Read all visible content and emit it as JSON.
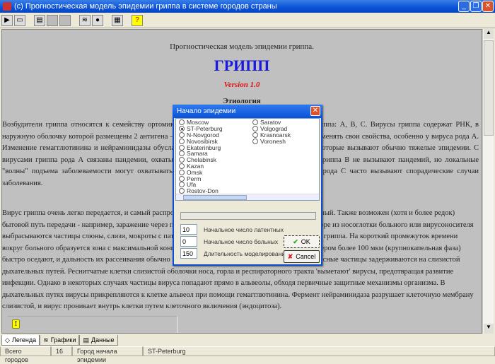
{
  "window": {
    "title": "(c) Прогностическая модель эпидемии гриппа в системе городов страны",
    "min": "_",
    "max": "❐",
    "close": "✕"
  },
  "toolbar": [
    {
      "icon": "open-icon",
      "g": "▶"
    },
    {
      "icon": "folder-icon",
      "g": "▭"
    },
    {
      "icon": "table-icon",
      "g": "▤"
    },
    {
      "icon": "disabled-icon",
      "g": ""
    },
    {
      "icon": "disabled-chart-icon",
      "g": ""
    },
    {
      "icon": "chart-icon",
      "g": "≋"
    },
    {
      "icon": "globe-icon",
      "g": "●"
    },
    {
      "icon": "export-icon",
      "g": "▦"
    },
    {
      "icon": "help-icon",
      "g": "?"
    }
  ],
  "doc": {
    "heading": "Прогностическая модель эпидемии гриппа.",
    "title": "ГРИПП",
    "version": "Version 1.0",
    "section": "Этиология",
    "p1": "Возбудители гриппа относятся к семейству ортомиксовирусов. Существует три рода вирусов гриппа: А, В, С. Вирусы гриппа содержат РНК, в наружную оболочку которой размещены 2 антигена – гемагглютинин и нейраминидаза, способные менять свои свойства, особенно у вируса рода А. Изменение гемагглютинина и нейраминидазы обуславливает появление новых подтипов вируса, которые вызывают обычно тяжелые эпидемии. С вирусами гриппа рода А связаны пандемии, охватывающие территорию всей планеты. Вирусы гриппа В не вызывают пандемий, но локальные \"волны\" подъема заболеваемости могут охватывать одну или несколько стран. Вирусы гриппа рода С часто вызывают спорадические случаи заболевания.",
    "p2": "Вирус гриппа очень легко передается, и самый распространенный путь передачи – воздушно-капельный. Также возможен (хотя и более редок) бытовой путь передачи - например, заражение через предметы обихода. При кашле, чихании, разговоре из носоглотки больного или вирусоносителя выбрасываются частицы слюны, слизи, мокроты с патогенной микрофлорой, в том числе с вирусами гриппа. На короткий промежуток времени вокруг больного образуется зона с максимальной концентрацией аэрозольных частиц. Частицы размером более 100 мкм (крупнокапельная фаза) быстро оседают, и дальность их рассеивания обычно не превышает 2-3 метра. После заражения вирусные частицы задерживаются на слизистой дыхательных путей. Реснитчатые клетки слизистой оболочки носа, горла и респираторного тракта 'выметают' вирусы, предотвращая развитие инфекции. Однако в некоторых случаях частицы вируса попадают прямо в альвеолы, обходя первичные защитные механизмы организма. В дыхательных путях вирусы прикрепляются к клетке альвеол при помощи гемагглютинина. Фермент нейраминидаза разрушает клеточную мембрану слизистой, и вирус проникает внутрь клетки путем клеточного включения (эндоцитоза)."
  },
  "note_icon": "!",
  "tabs": [
    {
      "label": "Легенда",
      "icon": "legend-icon",
      "g": "◇"
    },
    {
      "label": "Графики",
      "icon": "chart-icon",
      "g": "≋"
    },
    {
      "label": "Данные",
      "icon": "table-icon",
      "g": "▤"
    }
  ],
  "status": {
    "cities_label": "Всего городов",
    "cities_value": "16",
    "start_label": "Город начала эпидемии",
    "start_value": "ST-Peterburg"
  },
  "dialog": {
    "title": "Начало эпидемии",
    "cities_col1": [
      "Moscow",
      "ST-Peterburg",
      "N-Novgorod",
      "Novosibirsk",
      "Ekaterinburg",
      "Samara",
      "Chelabinsk",
      "Kazan",
      "Omsk",
      "Perm",
      "Ufa",
      "Rostov-Don"
    ],
    "cities_col2": [
      "Saratov",
      "Volgograd",
      "Krasnoarsk",
      "Voronesh"
    ],
    "selected": "ST-Peterburg",
    "latent_value": "10",
    "latent_label": "Начальное число латентных",
    "sick_value": "0",
    "sick_label": "Начальное число больных",
    "duration_value": "150",
    "duration_label": "Длительность моделирования",
    "ok": "OK",
    "cancel": "Cancel"
  }
}
